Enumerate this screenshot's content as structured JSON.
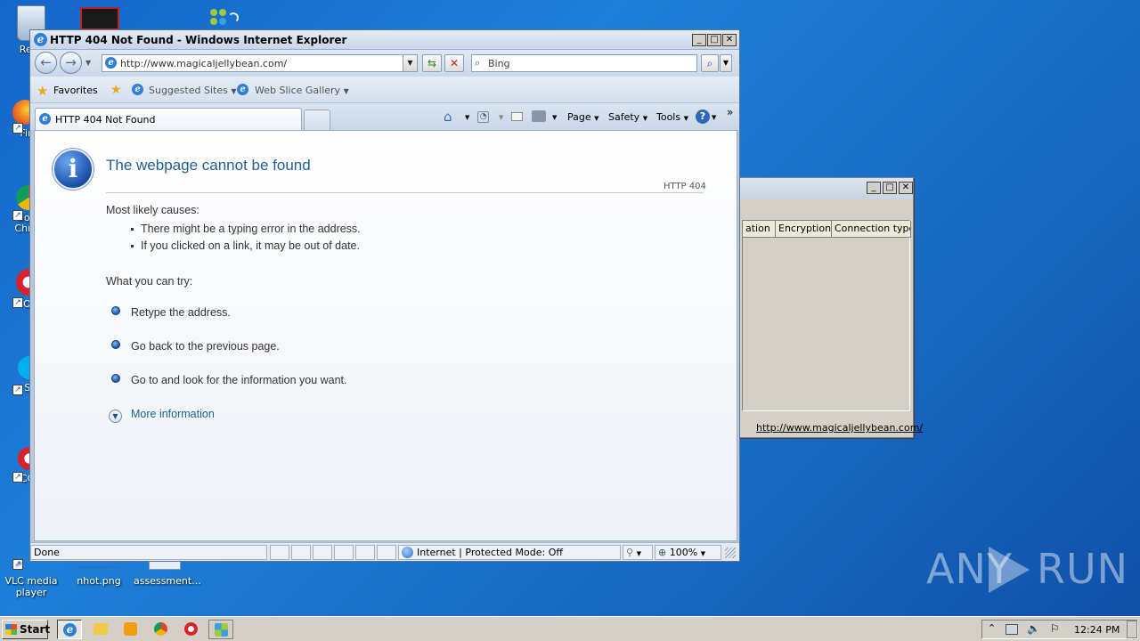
{
  "desktop": {
    "icons": [
      {
        "label": "Recy",
        "key": "recycle-bin"
      },
      {
        "label": "Fir",
        "key": "firefox"
      },
      {
        "label": "Go Chr",
        "key": "chrome"
      },
      {
        "label": "Op",
        "key": "opera"
      },
      {
        "label": "Sk",
        "key": "skype"
      },
      {
        "label": "CCl",
        "key": "ccleaner"
      },
      {
        "label": "VLC media player",
        "key": "vlc"
      },
      {
        "label": "nhot.png",
        "key": "png-file"
      },
      {
        "label": "assessment...",
        "key": "assessment"
      }
    ]
  },
  "bg_dialog": {
    "columns": [
      "ation",
      "Encryption",
      "Connection type"
    ],
    "url": "http://www.magicaljellybean.com/"
  },
  "ie": {
    "title": "HTTP 404 Not Found - Windows Internet Explorer",
    "address": "http://www.magicaljellybean.com/",
    "search_placeholder": "Bing",
    "favorites_label": "Favorites",
    "suggested_sites": "Suggested Sites",
    "web_slice_gallery": "Web Slice Gallery",
    "tab_title": "HTTP 404 Not Found",
    "commands": {
      "page": "Page",
      "safety": "Safety",
      "tools": "Tools"
    }
  },
  "content": {
    "heading": "The webpage cannot be found",
    "code": "HTTP 404",
    "causes_title": "Most likely causes:",
    "causes": [
      "There might be a typing error in the address.",
      "If you clicked on a link, it may be out of date."
    ],
    "try_title": "What you can try:",
    "tries": [
      "Retype the address.",
      "Go back to the previous page.",
      "Go to  and look for the information you want."
    ],
    "more_info": "More information"
  },
  "status": {
    "text": "Done",
    "zone": "Internet | Protected Mode: Off",
    "zoom": "100%"
  },
  "taskbar": {
    "start": "Start",
    "clock": "12:24 PM"
  },
  "watermark": {
    "left": "ANY",
    "right": "RUN"
  }
}
